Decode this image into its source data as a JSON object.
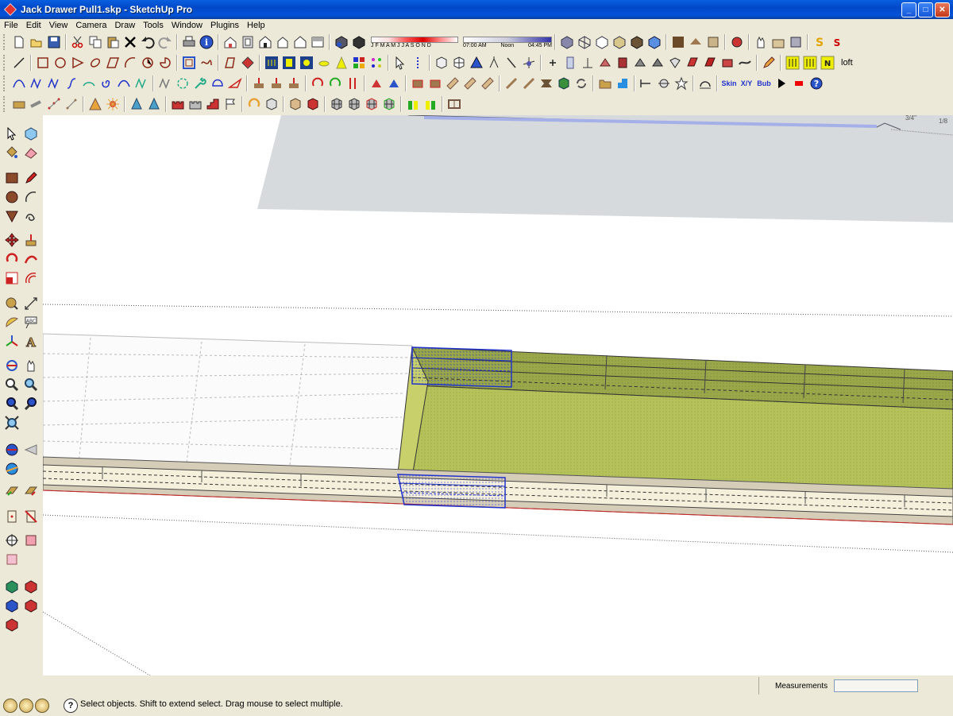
{
  "window": {
    "title": "Jack Drawer Pull1.skp - SketchUp Pro",
    "controls": [
      "minimize",
      "maximize",
      "close"
    ]
  },
  "menubar": {
    "items": [
      "File",
      "Edit",
      "View",
      "Camera",
      "Draw",
      "Tools",
      "Window",
      "Plugins",
      "Help"
    ]
  },
  "shadow_settings": {
    "months": "J F M A M J J A S O N D",
    "time_start": "07:00 AM",
    "time_mid": "Noon",
    "time_end": "04:45 PM"
  },
  "toolbar_labels": {
    "loft": "loft",
    "skin": "Skin",
    "xyz": "X/Y",
    "bub": "Bub"
  },
  "viewport": {
    "dimension_label": "3/4\"",
    "dimension_label2": "1/8"
  },
  "statusbar": {
    "hint": "Select objects. Shift to extend select. Drag mouse to select multiple.",
    "measurements_label": "Measurements",
    "measurements_value": ""
  },
  "colors": {
    "model_green": "#b5c25a",
    "model_cream": "#f5f0dc",
    "selection_blue": "#2233cc",
    "ground_gray": "#d7dadd"
  }
}
